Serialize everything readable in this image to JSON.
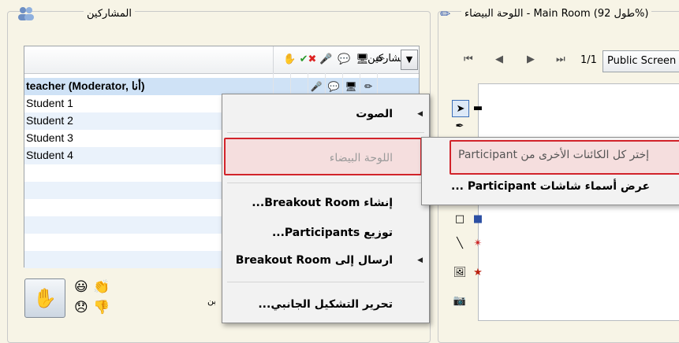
{
  "participants_panel": {
    "title": "المشاركين",
    "list_header": "المشاركين",
    "rows": [
      {
        "name": "teacher (Moderator, أنا)"
      },
      {
        "name": "Student 1"
      },
      {
        "name": "Student 2"
      },
      {
        "name": "Student 3"
      },
      {
        "name": "Student 4"
      }
    ],
    "dropdown_glyph": "▼",
    "partial_label": "ين"
  },
  "whiteboard_panel": {
    "title": "اللوحة البيضاء - Main Room (طول 92%)",
    "page_indicator": "1/1",
    "screen_selector_value": "Public Screen",
    "nav": {
      "first": "⏮",
      "prev": "◀",
      "next": "▶",
      "last": "⏭"
    }
  },
  "context_menu": {
    "items": [
      {
        "label": "الصوت",
        "has_submenu": true,
        "enabled": true
      },
      {
        "label": "اللوحة البيضاء",
        "has_submenu": false,
        "enabled": false
      },
      {
        "label": "إنشاء Breakout Room...",
        "has_submenu": false,
        "enabled": true
      },
      {
        "label": "توزيع Participants...",
        "has_submenu": false,
        "enabled": true
      },
      {
        "label": "ارسال إلى Breakout Room",
        "has_submenu": true,
        "enabled": true
      },
      {
        "label": "تحرير التشكيل الجانبي...",
        "has_submenu": false,
        "enabled": true
      }
    ]
  },
  "whiteboard_submenu": {
    "items": [
      {
        "label": "إختر كل الكائنات الأخرى من Participant"
      },
      {
        "label": "عرض أسماء شاشات Participant ..."
      }
    ]
  },
  "colors": {
    "highlight_red": "#d2232a",
    "selection_blue": "#cfe2f6",
    "background": "#f7f4e6"
  }
}
